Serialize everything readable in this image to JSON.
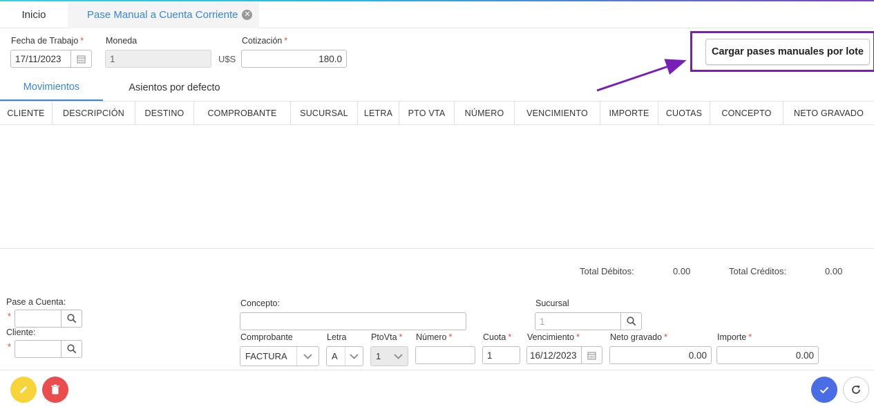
{
  "tabs": {
    "home": "Inicio",
    "active": "Pase Manual a Cuenta Corriente"
  },
  "header": {
    "fecha_label": "Fecha de Trabajo",
    "fecha_value": "17/11/2023",
    "moneda_label": "Moneda",
    "moneda_value": "1",
    "moneda_symbol": "U$S",
    "cotizacion_label": "Cotización",
    "cotizacion_value": "180.0",
    "required_mark": "*",
    "cargar_button": "Cargar pases manuales por lote"
  },
  "subtabs": {
    "movimientos": "Movimientos",
    "asientos": "Asientos por defecto"
  },
  "table": {
    "columns": [
      "CLIENTE",
      "DESCRIPCIÓN",
      "DESTINO",
      "COMPROBANTE",
      "SUCURSAL",
      "LETRA",
      "PTO VTA",
      "NÚMERO",
      "VENCIMIENTO",
      "IMPORTE",
      "CUOTAS",
      "CONCEPTO",
      "NETO GRAVADO"
    ],
    "rows": []
  },
  "totals": {
    "debitos_label": "Total Débitos:",
    "debitos_value": "0.00",
    "creditos_label": "Total Créditos:",
    "creditos_value": "0.00"
  },
  "form": {
    "pase_label": "Pase a Cuenta:",
    "pase_value": "",
    "cliente_label": "Cliente:",
    "cliente_value": "",
    "concepto_label": "Concepto:",
    "concepto_value": "",
    "sucursal_label": "Sucursal",
    "sucursal_placeholder": "1",
    "comprobante_label": "Comprobante",
    "comprobante_value": "FACTURA",
    "letra_label": "Letra",
    "letra_value": "A",
    "ptovta_label": "PtoVta",
    "ptovta_value": "1",
    "numero_label": "Número",
    "numero_value": "",
    "cuota_label": "Cuota",
    "cuota_value": "1",
    "vencimiento_label": "Vencimiento",
    "vencimiento_value": "16/12/2023",
    "neto_label": "Neto gravado",
    "neto_value": "0.00",
    "importe_label": "Importe",
    "importe_value": "0.00"
  },
  "colors": {
    "accent": "#3a86d6",
    "highlight": "#7a1fb5",
    "edit_fab": "#f7d53a",
    "delete_fab": "#e94e4e",
    "confirm_fab": "#4a6de5"
  },
  "icons": {
    "calendar": "calendar-icon",
    "search": "search-icon",
    "close": "close-icon",
    "chevron": "chevron-down-icon",
    "edit": "pencil-icon",
    "delete": "trash-icon",
    "confirm": "check-icon",
    "refresh": "refresh-icon"
  }
}
